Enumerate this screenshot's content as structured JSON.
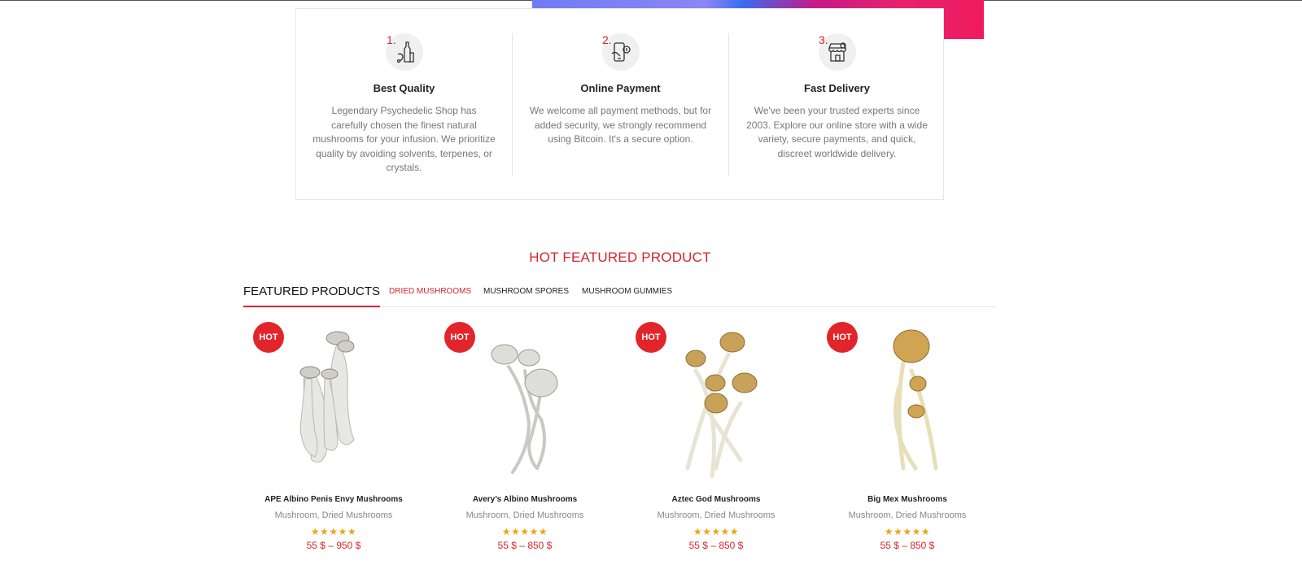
{
  "features": [
    {
      "num": "1.",
      "title": "Best Quality",
      "desc": "Legendary Psychedelic Shop has carefully chosen the finest natural mushrooms for your infusion. We prioritize quality by avoiding solvents, terpenes, or crystals.",
      "icon": "bottles-icon"
    },
    {
      "num": "2.",
      "title": "Online Payment",
      "desc": "We welcome all payment methods, but for added security, we strongly recommend using Bitcoin. It's a secure option.",
      "icon": "phone-payment-icon"
    },
    {
      "num": "3.",
      "title": "Fast Delivery",
      "desc": "We've been your trusted experts since 2003. Explore our online store with a wide variety, secure payments, and quick, discreet worldwide delivery.",
      "icon": "storefront-icon"
    }
  ],
  "section": {
    "title": "HOT FEATURED PRODUCT"
  },
  "tabs": {
    "main": "FEATURED PRODUCTS",
    "items": [
      "DRIED MUSHROOMS",
      "MUSHROOM SPORES",
      "MUSHROOM GUMMIES"
    ],
    "active_index": 0
  },
  "products": [
    {
      "badge": "HOT",
      "name": "APE Albino Penis Envy Mushrooms",
      "category": "Mushroom, Dried Mushrooms",
      "stars": "★★★★★",
      "rating": 5,
      "price": "55 $ – 950 $"
    },
    {
      "badge": "HOT",
      "name": "Avery’s Albino Mushrooms",
      "category": "Mushroom, Dried Mushrooms",
      "stars": "★★★★★",
      "rating": 5,
      "price": "55 $ – 850 $"
    },
    {
      "badge": "HOT",
      "name": "Aztec God Mushrooms",
      "category": "Mushroom, Dried Mushrooms",
      "stars": "★★★★★",
      "rating": 5,
      "price": "55 $ – 850 $"
    },
    {
      "badge": "HOT",
      "name": "Big Mex Mushrooms",
      "category": "Mushroom, Dried Mushrooms",
      "stars": "★★★★★",
      "rating": 5,
      "price": "55 $ – 850 $"
    }
  ],
  "colors": {
    "accent": "#d9242b",
    "badge": "#e2252b",
    "stars": "#e6a817"
  }
}
